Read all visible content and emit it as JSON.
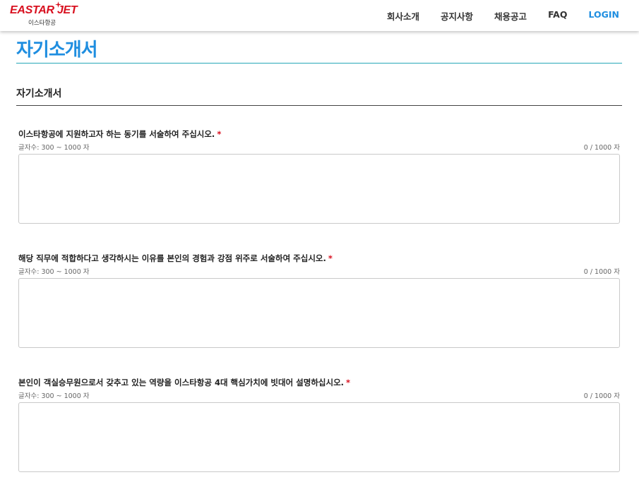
{
  "header": {
    "logo_text": "EASTAR JET",
    "logo_sub": "이스타항공",
    "nav": [
      "회사소개",
      "공지사항",
      "채용공고",
      "FAQ"
    ],
    "login_label": "LOGIN",
    "accent_color": "#1f8ee0",
    "brand_color": "#d8101f"
  },
  "page": {
    "title": "자기소개서",
    "section_title": "자기소개서"
  },
  "questions": [
    {
      "label": "이스타항공에 지원하고자 하는 동기를 서술하여 주십시오.",
      "required": "*",
      "hint": "글자수: 300 ~ 1000 자",
      "count": "0 / 1000 자",
      "value": ""
    },
    {
      "label": "해당 직무에 적합하다고 생각하시는 이유를 본인의 경험과 강점 위주로 서술하여 주십시오.",
      "required": "*",
      "hint": "글자수: 300 ~ 1000 자",
      "count": "0 / 1000 자",
      "value": ""
    },
    {
      "label": "본인이 객실승무원으로서 갖추고 있는 역량을 이스타항공 4대 핵심가치에 빗대어 설명하십시오.",
      "required": "*",
      "hint": "글자수: 300 ~ 1000 자",
      "count": "0 / 1000 자",
      "value": ""
    }
  ]
}
